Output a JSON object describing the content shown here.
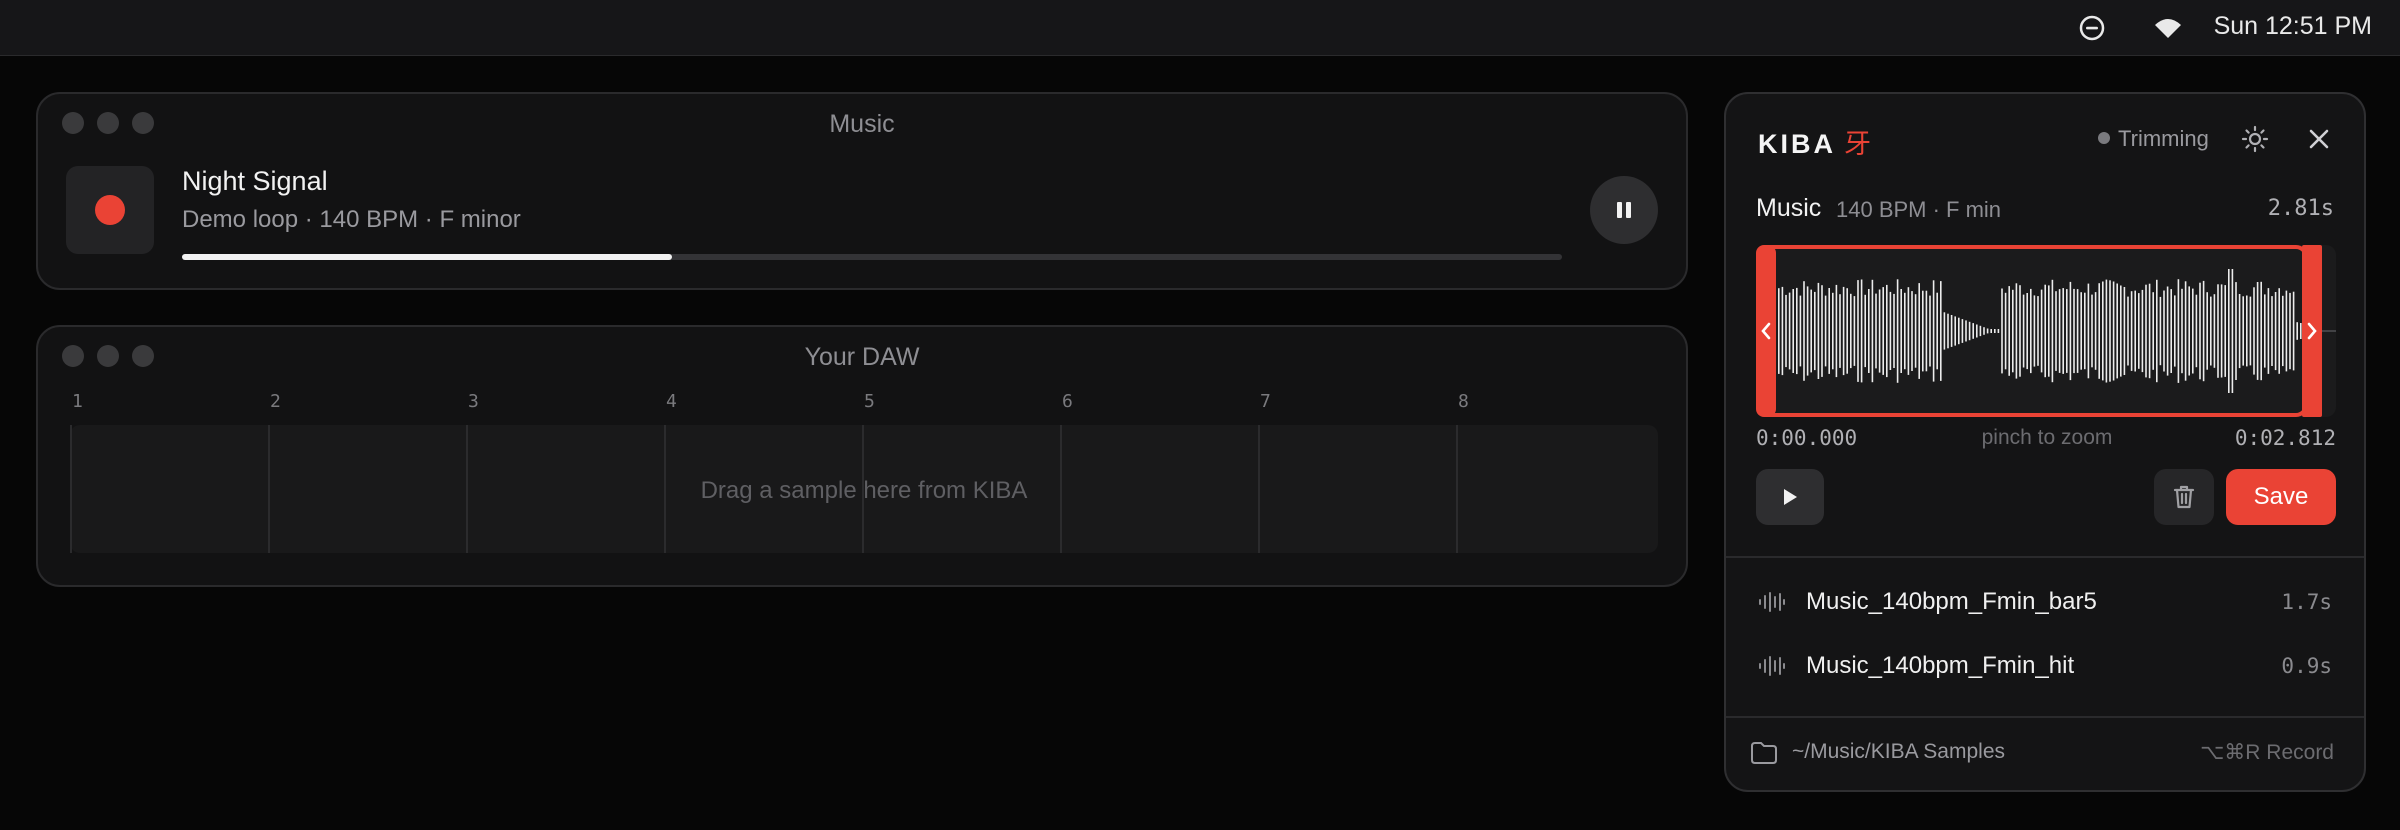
{
  "menubar": {
    "clock": "Sun 12:51 PM",
    "icons": [
      "do-not-disturb-icon",
      "wifi-icon"
    ]
  },
  "music_window": {
    "title": "Music",
    "track_name": "Night Signal",
    "track_meta": "Demo loop · 140 BPM · F minor",
    "progress_fraction": 0.355,
    "state": "playing"
  },
  "daw_window": {
    "title": "Your DAW",
    "bars": [
      "1",
      "2",
      "3",
      "4",
      "5",
      "6",
      "7",
      "8"
    ],
    "drop_hint": "Drag a sample here from KIBA"
  },
  "kiba": {
    "brand": "KIBA",
    "brand_kanji": "牙",
    "status": "Trimming",
    "source_label": "Music",
    "source_meta": "140 BPM · F min",
    "duration": "2.81s",
    "time_start": "0:00.000",
    "time_end": "0:02.812",
    "zoom_hint": "pinch to zoom",
    "save_label": "Save",
    "samples": [
      {
        "name": "Music_140bpm_Fmin_bar5",
        "length": "1.7s"
      },
      {
        "name": "Music_140bpm_Fmin_hit",
        "length": "0.9s"
      }
    ],
    "folder_path": "~/Music/KIBA Samples",
    "shortcut": "⌥⌘R Record",
    "accent_color": "#ea4335"
  }
}
